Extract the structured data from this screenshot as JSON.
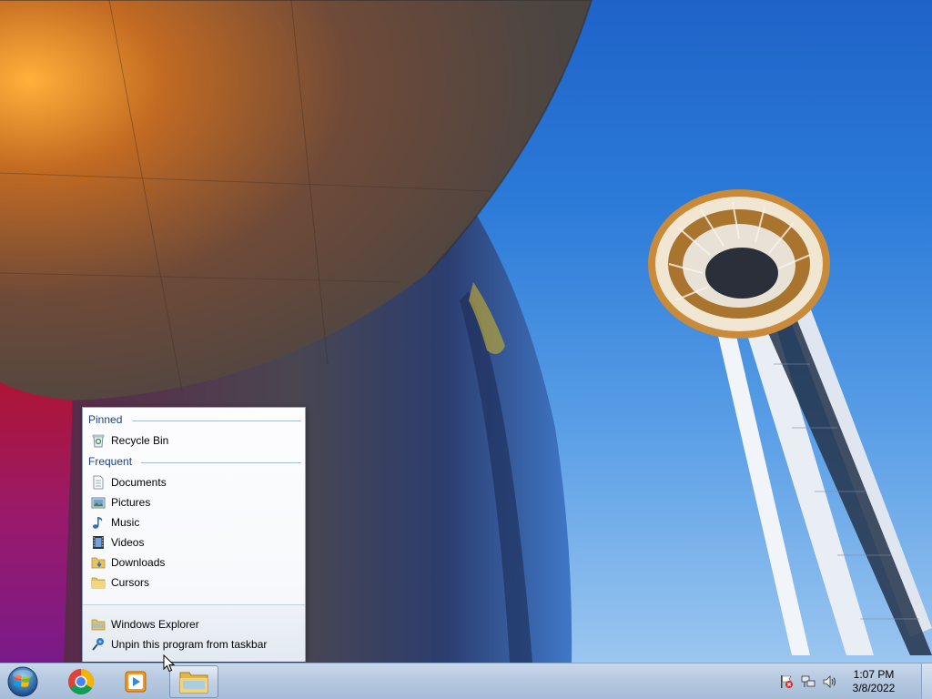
{
  "jumplist": {
    "pinned_header": "Pinned",
    "pinned": [
      {
        "label": "Recycle Bin",
        "icon": "recycle-bin-icon"
      }
    ],
    "frequent_header": "Frequent",
    "frequent": [
      {
        "label": "Documents",
        "icon": "documents-icon"
      },
      {
        "label": "Pictures",
        "icon": "pictures-icon"
      },
      {
        "label": "Music",
        "icon": "music-icon"
      },
      {
        "label": "Videos",
        "icon": "videos-icon"
      },
      {
        "label": "Downloads",
        "icon": "downloads-folder-icon"
      },
      {
        "label": "Cursors",
        "icon": "folder-icon"
      }
    ],
    "tasks": [
      {
        "label": "Windows Explorer",
        "icon": "windows-explorer-icon"
      },
      {
        "label": "Unpin this program from taskbar",
        "icon": "unpin-icon"
      }
    ]
  },
  "taskbar": {
    "pinned_apps": [
      {
        "name": "Google Chrome",
        "icon": "chrome-icon"
      },
      {
        "name": "Windows Media Player",
        "icon": "media-player-icon"
      },
      {
        "name": "Windows Explorer",
        "icon": "folder-icon",
        "active": true
      }
    ],
    "tray_icons": [
      "action-center-flag-icon",
      "network-icon",
      "volume-icon"
    ],
    "clock": {
      "time": "1:07 PM",
      "date": "3/8/2022"
    }
  },
  "colors": {
    "section_header": "#1e3f8a",
    "taskbar_top": "#c9d8ea",
    "sky": "#2b7ad8"
  }
}
